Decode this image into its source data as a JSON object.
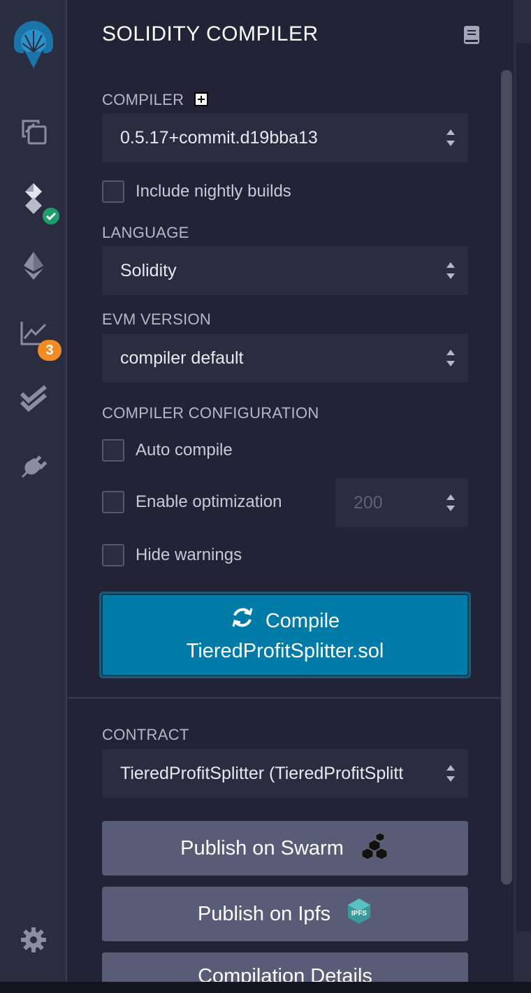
{
  "panel": {
    "title": "SOLIDITY COMPILER",
    "compiler_label": "COMPILER",
    "compiler_value": "0.5.17+commit.d19bba13",
    "nightly_label": "Include nightly builds",
    "language_label": "LANGUAGE",
    "language_value": "Solidity",
    "evm_label": "EVM VERSION",
    "evm_value": "compiler default",
    "config_label": "COMPILER CONFIGURATION",
    "auto_compile_label": "Auto compile",
    "optimization_label": "Enable optimization",
    "runs_value": "200",
    "hide_warnings_label": "Hide warnings",
    "compile_line1": "Compile",
    "compile_line2": "TieredProfitSplitter.sol",
    "contract_label": "CONTRACT",
    "contract_value": "TieredProfitSplitter (TieredProfitSplitt",
    "publish_swarm": "Publish on Swarm",
    "publish_ipfs": "Publish on Ipfs",
    "ipfs_icon_text": "IPFS",
    "compilation_details": "Compilation Details"
  },
  "rail": {
    "analysis_badge": "3"
  },
  "icons": {
    "logo": "remix-logo-icon",
    "file_explorer": "files-icon",
    "compiler": "solidity-icon",
    "deploy": "ethereum-icon",
    "analysis": "chart-line-icon",
    "testing": "double-check-icon",
    "plugins": "plug-icon",
    "settings": "gear-icon",
    "docs": "book-icon",
    "compile": "refresh-icon",
    "swarm": "swarm-icon",
    "ipfs": "ipfs-icon"
  },
  "colors": {
    "accent": "#007aa6",
    "success_badge": "#1e9e6c",
    "warning_badge": "#f28b23"
  }
}
